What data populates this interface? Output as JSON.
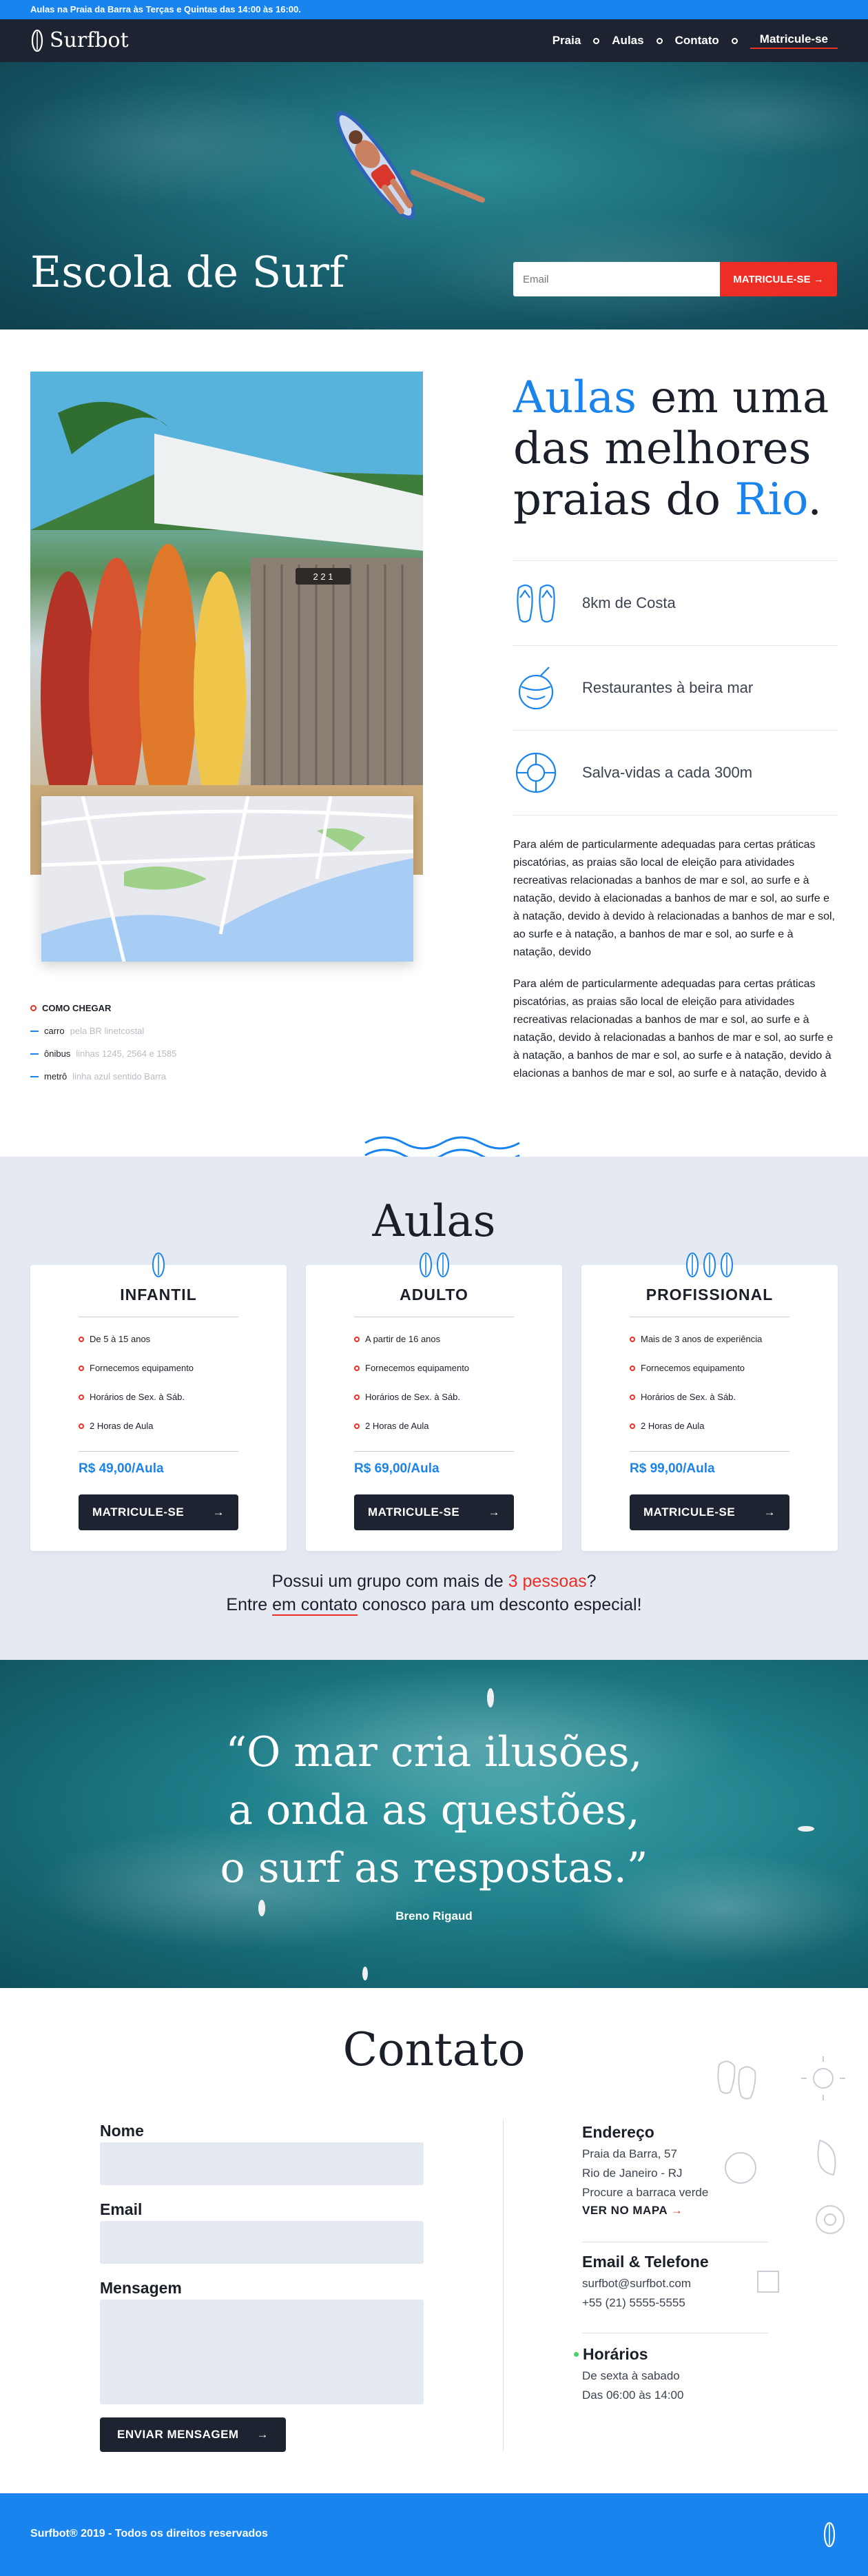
{
  "topbar": {
    "text": "Aulas na Praia da Barra às Terças e Quintas das 14:00 às 16:00."
  },
  "nav": {
    "logo": "Surfbot",
    "links": [
      "Praia",
      "Aulas",
      "Contato"
    ],
    "cta": "Matricule-se"
  },
  "hero": {
    "title": "Escola de Surf",
    "email_placeholder": "Email",
    "button": "MATRICULE-SE"
  },
  "about": {
    "headline_blue1": "Aulas",
    "headline_mid": " em uma das melhores praias do ",
    "headline_blue2": "Rio",
    "headline_end": ".",
    "features": [
      {
        "icon": "flip-flops-icon",
        "label": "8km de Costa"
      },
      {
        "icon": "coconut-drink-icon",
        "label": "Restaurantes à beira mar"
      },
      {
        "icon": "lifebuoy-icon",
        "label": "Salva-vidas a cada 300m"
      }
    ],
    "paragraphs": [
      "Para além de particularmente adequadas para certas práticas piscatórias, as praias são local de eleição para atividades recreativas relacionadas a banhos de mar e sol, ao surfe e à natação, devido à elacionadas a banhos de mar e sol, ao surfe e à natação, devido à devido à relacionadas a banhos de mar e sol, ao surfe e à natação, a banhos de mar e sol, ao surfe e à natação, devido",
      "Para além de particularmente adequadas para certas práticas piscatórias, as praias são local de eleição para atividades recreativas relacionadas a banhos de mar e sol, ao surfe e à natação, devido à relacionadas a banhos de mar e sol, ao surfe e à natação, a banhos de mar e sol, ao surfe e à natação, devido à elacionas a banhos de mar e sol, ao surfe e à natação, devido à"
    ],
    "house_number": "2 2 1",
    "how_to": {
      "title": "COMO CHEGAR",
      "rows": [
        {
          "label": "carro",
          "detail": "pela BR linetcostal"
        },
        {
          "label": "ônibus",
          "detail": "linhas 1245, 2564 e 1585"
        },
        {
          "label": "metrô",
          "detail": "linha azul sentido Barra"
        }
      ]
    }
  },
  "aulas": {
    "title": "Aulas",
    "cards": [
      {
        "title": "INFANTIL",
        "icon": "surfboard-icon",
        "count": 1,
        "items": [
          "De 5 à 15 anos",
          "Fornecemos equipamento",
          "Horários de Sex. à Sáb.",
          "2 Horas de Aula"
        ],
        "price": "R$ 49,00/Aula",
        "button": "MATRICULE-SE"
      },
      {
        "title": "ADULTO",
        "icon": "surfboard-icon",
        "count": 2,
        "items": [
          "A partir de 16 anos",
          "Fornecemos equipamento",
          "Horários de Sex. à Sáb.",
          "2 Horas de Aula"
        ],
        "price": "R$ 69,00/Aula",
        "button": "MATRICULE-SE"
      },
      {
        "title": "PROFISSIONAL",
        "icon": "surfboard-icon",
        "count": 3,
        "items": [
          "Mais de 3 anos de experiência",
          "Fornecemos equipamento",
          "Horários de Sex. à Sáb.",
          "2 Horas de Aula"
        ],
        "price": "R$ 99,00/Aula",
        "button": "MATRICULE-SE"
      }
    ],
    "group_a": "Possui um grupo com mais de ",
    "group_red": "3 pessoas",
    "group_b": "?",
    "group_c": "Entre ",
    "group_link": "em contato",
    "group_d": " conosco para um desconto especial!"
  },
  "quote": {
    "lines": [
      "“O mar cria ilusões,",
      "a onda as questões,",
      "o surf as respostas.”"
    ],
    "author": "Breno Rigaud"
  },
  "contato": {
    "title": "Contato",
    "form": {
      "name_label": "Nome",
      "email_label": "Email",
      "message_label": "Mensagem",
      "submit": "ENVIAR MENSAGEM"
    },
    "address": {
      "title": "Endereço",
      "lines": [
        "Praia da Barra, 57",
        "Rio de Janeiro - RJ",
        "Procure a barraca verde"
      ],
      "map_link": "VER NO MAPA"
    },
    "contact": {
      "title": "Email & Telefone",
      "lines": [
        "surfbot@surfbot.com",
        "+55 (21) 5555-5555"
      ]
    },
    "hours": {
      "title": "Horários",
      "lines": [
        "De sexta à sabado",
        "Das 06:00 às 14:00"
      ]
    }
  },
  "footer": {
    "text": "Surfbot® 2019 - Todos os direitos reservados"
  },
  "colors": {
    "brand_blue": "#1a84ee",
    "accent_red": "#ee2d24",
    "dark": "#1d2330",
    "section_bg": "#e5eaf2"
  }
}
